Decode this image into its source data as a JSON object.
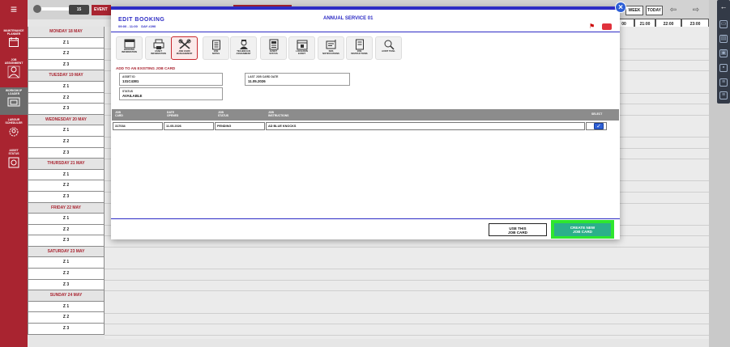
{
  "left_sidebar": {
    "menu_icon": "hamburger-icon",
    "items": [
      {
        "label": "MAINTENANCE\nPLANNER",
        "icon": "calendar-icon"
      },
      {
        "label": "JOB\nASSIGNMENT",
        "icon": "person-icon"
      },
      {
        "label": "WORKSHOP\nLOADER",
        "icon": "truck-icon",
        "active": true
      },
      {
        "label": "LABOUR\nSCHEDULER",
        "icon": "gear-person-icon"
      },
      {
        "label": "ASSET\nSTATUS",
        "icon": "asset-status-icon"
      }
    ]
  },
  "top_controls": {
    "slider_value": "15",
    "event_label": "EVENT T",
    "week_label": "WEEK",
    "today_label": "TODAY",
    "prev_icon": "arrow-left-icon",
    "next_icon": "arrow-right-icon"
  },
  "time_header": [
    "00",
    "21:00",
    "22:00",
    "23:00"
  ],
  "days": [
    {
      "name": "MONDAY 18 MAY",
      "rows": [
        "Z 1",
        "Z 2",
        "Z 3"
      ]
    },
    {
      "name": "TUESDAY 19 MAY",
      "rows": [
        "Z 1",
        "Z 2",
        "Z 3"
      ]
    },
    {
      "name": "WEDNESDAY 20 MAY",
      "rows": [
        "Z 1",
        "Z 2",
        "Z 3"
      ]
    },
    {
      "name": "THURSDAY 21 MAY",
      "rows": [
        "Z 1",
        "Z 2",
        "Z 3"
      ]
    },
    {
      "name": "FRIDAY 22 MAY",
      "rows": [
        "Z 1",
        "Z 2",
        "Z 3"
      ]
    },
    {
      "name": "SATURDAY 23 MAY",
      "rows": [
        "Z 1",
        "Z 2",
        "Z 3"
      ]
    },
    {
      "name": "SUNDAY 24 MAY",
      "rows": [
        "Z 1",
        "Z 2",
        "Z 3"
      ]
    }
  ],
  "modal": {
    "title": "EDIT BOOKING",
    "subtitle": "09:00 - 11:00    DAY #290",
    "service": "ANNUAL SERVICE 01",
    "close_icon": "close-icon",
    "flag_icon": "flag-icon",
    "tabs": [
      {
        "label": "BOOKING\nINFORMATION",
        "icon": "calendar-icon"
      },
      {
        "label": "ASSET\nINFORMATION",
        "icon": "printer-icon"
      },
      {
        "label": "JOB CARD\nMANAGEMENT",
        "icon": "tools-icon",
        "active": true
      },
      {
        "label": "JOB\nNOTES",
        "icon": "clipboard-icon"
      },
      {
        "label": "TECHNICIAN\nASSIGNMENT",
        "icon": "technician-icon"
      },
      {
        "label": "EVENT\nSTATUS",
        "icon": "status-icon"
      },
      {
        "label": "LOCK/JOIN\nEVENT",
        "icon": "lock-calendar-icon"
      },
      {
        "label": "SMS\nNOTIFICATIONS",
        "icon": "sms-icon"
      },
      {
        "label": "JOB\nINSTRUCTIONS",
        "icon": "instructions-icon"
      },
      {
        "label": "AUDIT TRAIL",
        "icon": "audit-icon"
      }
    ],
    "add_section_label": "ADD TO AN EXISTING JOB CARD",
    "fields": {
      "asset_id_label": "ASSET ID",
      "asset_id_value": "131C4381",
      "last_job_card_label": "LAST JOB CARD DATE",
      "last_job_card_value": "11.05.2026",
      "status_label": "STATUS",
      "status_value": "AVAILABLE"
    },
    "table": {
      "headers": [
        "JOB\nCARD",
        "DATE\nOPENED",
        "JOB\nSTATUS",
        "JOB\nINSTRUCTIONS",
        "SELECT"
      ],
      "rows": [
        {
          "job_card": "317034",
          "date_opened": "11.05.2026",
          "job_status": "PENDING",
          "instructions": "AD BLUE KNOCKS",
          "selected": true
        }
      ]
    },
    "use_button": "USE THIS\nJOB CARD",
    "create_button": "CREATE NEW\nJOB CARD"
  },
  "right_toolbar": {
    "icons": [
      "back-arrow-icon",
      "monitor-icon",
      "document-icon",
      "printer-icon",
      "truck-icon",
      "list-icon",
      "list-icon"
    ]
  },
  "colors": {
    "brand_red": "#a92430",
    "accent_blue": "#2d2cc5",
    "create_green": "#2bb08a",
    "highlight_green": "#2ee62e"
  }
}
